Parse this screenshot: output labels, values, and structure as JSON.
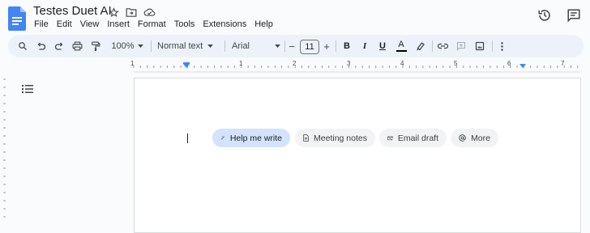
{
  "header": {
    "title": "Testes Duet AI",
    "menu": [
      "File",
      "Edit",
      "View",
      "Insert",
      "Format",
      "Tools",
      "Extensions",
      "Help"
    ],
    "icons": [
      "docs-logo-icon",
      "star-icon",
      "move-to-folder-icon",
      "cloud-saved-icon",
      "history-icon",
      "comments-icon"
    ]
  },
  "toolbar": {
    "zoom": "100%",
    "style": "Normal text",
    "font": "Arial",
    "font_size": "11",
    "minus": "−",
    "plus": "+",
    "bold": "B",
    "italic": "I",
    "underline": "U",
    "text_color_letter": "A"
  },
  "ruler": {
    "numbers": [
      "1",
      "1",
      "2",
      "3",
      "4",
      "5",
      "6",
      "7"
    ]
  },
  "chips": {
    "help_me_write": "Help me write",
    "meeting_notes": "Meeting notes",
    "email_draft": "Email draft",
    "more": "More"
  },
  "colors": {
    "docs_blue": "#4285f4",
    "toolbar_bg": "#edf2fa",
    "chip_primary": "#d3e3fd",
    "chip_bg": "#f1f3f4"
  }
}
